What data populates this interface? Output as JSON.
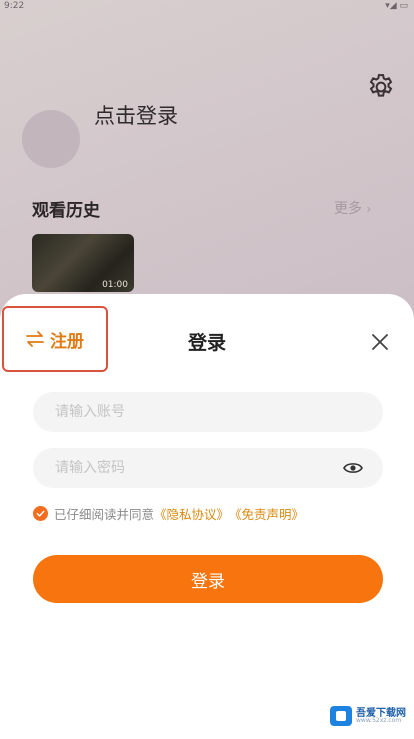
{
  "status_bar": {
    "left_text": "9:22",
    "right_text": "▾◢ ▭"
  },
  "profile": {
    "login_prompt": "点击登录",
    "settings_icon": "gear-icon"
  },
  "history": {
    "title": "观看历史",
    "more_label": "更多",
    "more_arrow": "›",
    "items": [
      {
        "duration": "01:00"
      }
    ]
  },
  "login_sheet": {
    "register_label": "注册",
    "register_icon": "swap-arrows-icon",
    "title": "登录",
    "close_icon": "close-icon",
    "account_placeholder": "请输入账号",
    "account_value": "",
    "password_placeholder": "请输入密码",
    "password_value": "",
    "password_toggle_icon": "eye-icon",
    "agreement": {
      "checked": true,
      "prefix": "已仔细阅读并同意",
      "privacy_link": "《隐私协议》",
      "disclaimer_link": "《免责声明》"
    },
    "login_button_label": "登录"
  },
  "colors": {
    "accent": "#f7740e",
    "link": "#d98a10",
    "highlight_border": "#d9533d"
  },
  "watermark": {
    "name": "吾爱下载网",
    "domain": "www.52xz.com"
  }
}
